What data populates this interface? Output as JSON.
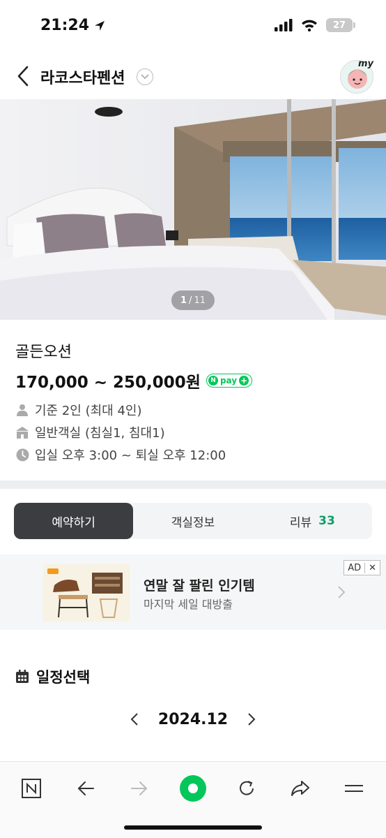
{
  "status_bar": {
    "time": "21:24",
    "battery": "27"
  },
  "header": {
    "title": "라코스타펜션",
    "avatar_label": "my"
  },
  "gallery": {
    "current": "1",
    "separator": "/",
    "total": "11"
  },
  "room": {
    "name": "골든오션",
    "price": "170,000 ~ 250,000원",
    "npay": {
      "n": "N",
      "label": "pay",
      "plus": "+"
    },
    "capacity": "기준 2인 (최대 4인)",
    "room_type": "일반객실 (침실1, 침대1)",
    "checkin_checkout": "입실 오후 3:00 ~ 퇴실 오후 12:00"
  },
  "tabs": [
    {
      "label": "예약하기",
      "active": true
    },
    {
      "label": "객실정보",
      "active": false
    },
    {
      "label": "리뷰",
      "count": "33",
      "active": false
    }
  ],
  "ad": {
    "title": "연말 잘 팔린 인기템",
    "subtitle": "마지막 세일 대방출",
    "badge": "AD",
    "close": "✕"
  },
  "schedule": {
    "title": "일정선택",
    "month": "2024.12"
  },
  "bottom_bar": {
    "n_logo": "N"
  },
  "colors": {
    "accent_green": "#03c75a",
    "review_green": "#0d9e6a",
    "active_tab": "#3b3d40"
  }
}
